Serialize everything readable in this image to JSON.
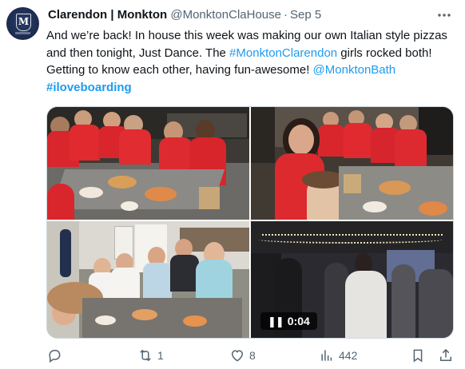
{
  "author": {
    "display_name": "Clarendon | Monkton",
    "handle": "@MonktonClaHouse",
    "separator": "·",
    "date": "Sep 5",
    "avatar_letter": "M"
  },
  "more_icon": "more-horizontal-icon",
  "tweet": {
    "line1": "And we’re back! In house this week was making our own Italian style pizzas and then tonight, Just Dance. The ",
    "hashtag1": "#MonktonClarendon",
    "line2": " girls rocked both! Getting to know each other, having fun-awesome! ",
    "mention": "@MonktonBath",
    "space": " ",
    "hashtag2": "#iloveboarding"
  },
  "media": {
    "video_duration": "0:04",
    "pause_glyph": "❚❚"
  },
  "actions": {
    "reply_count": "",
    "retweet_count": "1",
    "like_count": "8",
    "views_count": "442"
  },
  "colors": {
    "link": "#1d9bf0",
    "secondary_text": "#536471",
    "primary_text": "#0f1419"
  }
}
